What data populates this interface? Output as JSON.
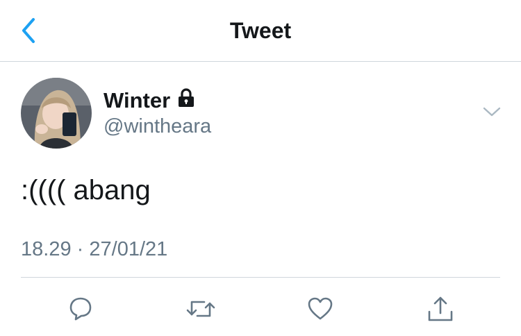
{
  "nav": {
    "title": "Tweet",
    "back_icon": "chevron-left-icon"
  },
  "tweet": {
    "author_name": "Winter",
    "handle": "@wintheara",
    "protected_icon": "lock-icon",
    "text": ":(((( abang",
    "time": "18.29",
    "separator": "·",
    "date": "27/01/21"
  },
  "actions": [
    "reply-icon",
    "retweet-icon",
    "like-icon",
    "share-icon"
  ],
  "colors": {
    "accent": "#1da1f2",
    "secondary_text": "#657786",
    "icon": "#657786",
    "divider": "#cfd6dc"
  }
}
